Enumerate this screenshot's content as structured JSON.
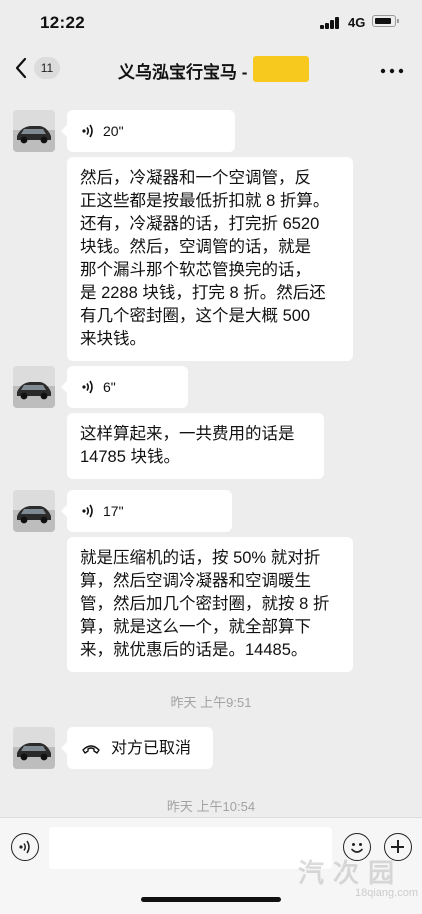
{
  "status_bar": {
    "time": "12:22",
    "network": "4G"
  },
  "nav": {
    "back_icon": "chevron-left-icon",
    "unread_count": "11",
    "title": "义乌泓宝行宝马 -",
    "more_icon": "more-dots-icon"
  },
  "messages": [
    {
      "type": "voice",
      "duration": "20\""
    },
    {
      "type": "text",
      "lines": [
        "然后，冷凝器和一个空调管，反",
        "正这些都是按最低折扣就 8 折算。",
        "还有，冷凝器的话，打完折 6520",
        "块钱。然后，空调管的话，就是",
        "那个漏斗那个软芯管换完的话，",
        "是 2288 块钱，打完 8 折。然后还",
        "有几个密封圈，这个是大概 500",
        "来块钱。"
      ]
    },
    {
      "type": "voice",
      "duration": "6\""
    },
    {
      "type": "text",
      "lines": [
        "这样算起来，一共费用的话是",
        "14785 块钱。"
      ]
    },
    {
      "type": "voice",
      "duration": "17\""
    },
    {
      "type": "text",
      "lines": [
        "就是压缩机的话，按 50% 就对折",
        "算，然后空调冷凝器和空调暖生",
        "管，然后加几个密封圈，就按 8 折",
        "算，就是这么一个，就全部算下",
        "来，就优惠后的话是。14485。"
      ]
    },
    {
      "type": "timestamp",
      "text": "昨天 上午9:51"
    },
    {
      "type": "call",
      "text": "对方已取消"
    },
    {
      "type": "timestamp",
      "text": "昨天 上午10:54"
    }
  ],
  "input_bar": {
    "placeholder": "",
    "voice_icon": "voice-toggle-icon",
    "emoji_icon": "emoji-icon",
    "plus_icon": "plus-icon"
  },
  "watermark": {
    "logo": "汽 次 园",
    "url": "18qiang.com"
  },
  "colors": {
    "background": "#ededed",
    "bubble": "#ffffff",
    "redaction": "#f7c91f",
    "timestamp": "#a3a3a3"
  }
}
